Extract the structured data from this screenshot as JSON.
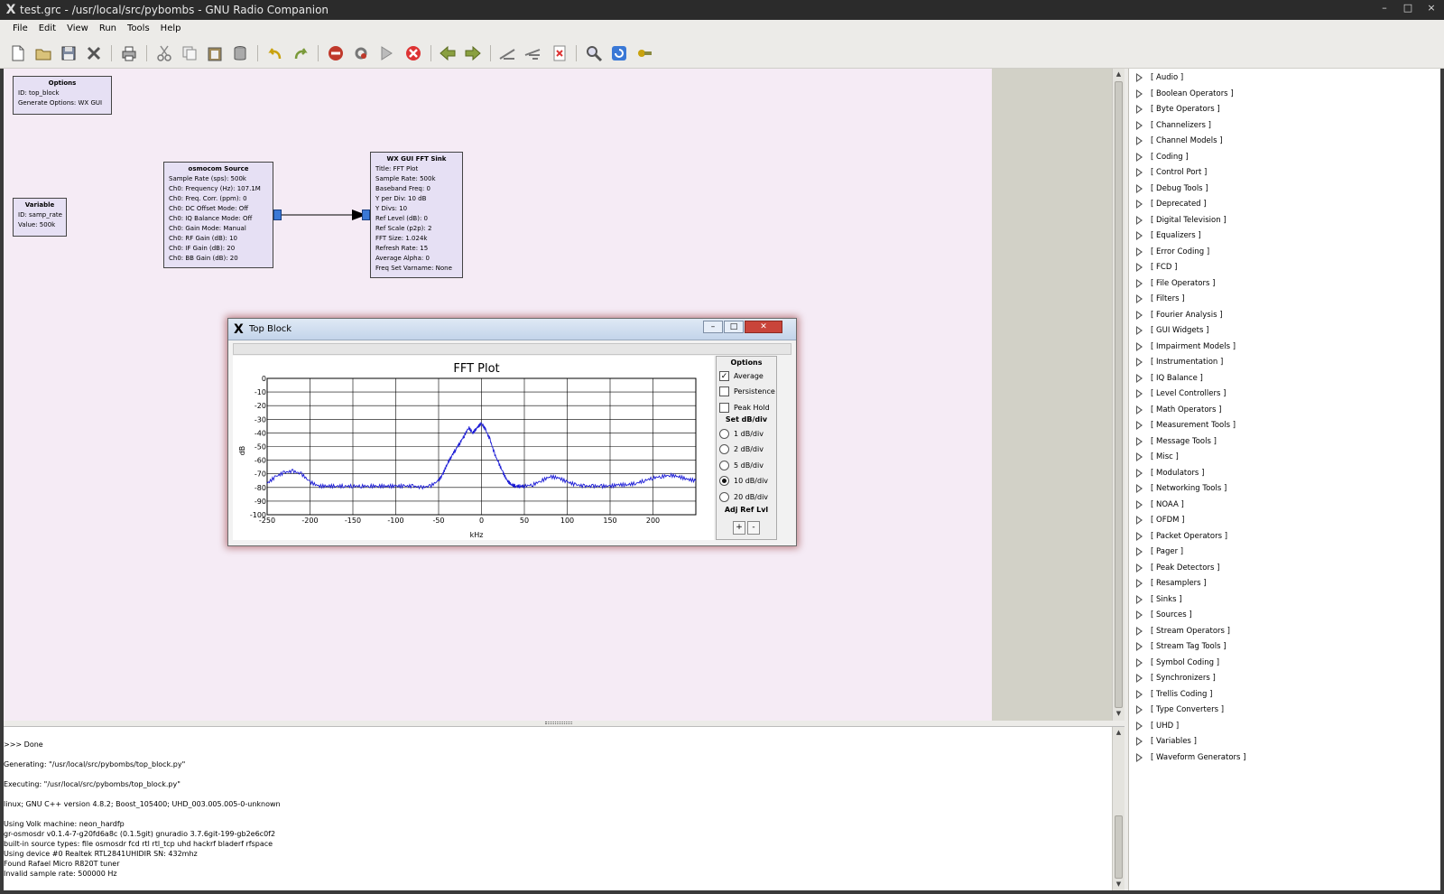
{
  "window": {
    "title": "test.grc - /usr/local/src/pybombs - GNU Radio Companion",
    "controls": [
      "–",
      "□",
      "×"
    ]
  },
  "menu": [
    "File",
    "Edit",
    "View",
    "Run",
    "Tools",
    "Help"
  ],
  "toolbar_icons": [
    "new-icon",
    "open-icon",
    "save-icon",
    "close-icon",
    "print-icon",
    "cut-icon",
    "copy-icon",
    "paste-icon",
    "delete-icon",
    "undo-icon",
    "redo-icon",
    "disable-icon",
    "generate-icon",
    "execute-icon",
    "kill-icon",
    "rotate-ccw-icon",
    "rotate-cw-icon",
    "enable-icon",
    "disable-block-icon",
    "errors-icon",
    "find-icon",
    "reload-icon",
    "open-hier-icon"
  ],
  "blocks": {
    "options": {
      "title": "Options",
      "params": [
        "ID: top_block",
        "Generate Options: WX GUI"
      ]
    },
    "variable": {
      "title": "Variable",
      "params": [
        "ID: samp_rate",
        "Value: 500k"
      ]
    },
    "source": {
      "title": "osmocom Source",
      "params": [
        "Sample Rate (sps): 500k",
        "Ch0: Frequency (Hz): 107.1M",
        "Ch0: Freq. Corr. (ppm): 0",
        "Ch0: DC Offset Mode: Off",
        "Ch0: IQ Balance Mode: Off",
        "Ch0: Gain Mode: Manual",
        "Ch0: RF Gain (dB): 10",
        "Ch0: IF Gain (dB): 20",
        "Ch0: BB Gain (dB): 20"
      ]
    },
    "sink": {
      "title": "WX GUI FFT Sink",
      "params": [
        "Title: FFT Plot",
        "Sample Rate: 500k",
        "Baseband Freq: 0",
        "Y per Div: 10 dB",
        "Y Divs: 10",
        "Ref Level (dB): 0",
        "Ref Scale (p2p): 2",
        "FFT Size: 1.024k",
        "Refresh Rate: 15",
        "Average Alpha: 0",
        "Freq Set Varname: None"
      ]
    }
  },
  "top_block_window": {
    "title": "Top Block",
    "options": {
      "heading": "Options",
      "checkboxes": [
        {
          "label": "Average",
          "checked": true
        },
        {
          "label": "Persistence",
          "checked": false
        },
        {
          "label": "Peak Hold",
          "checked": false
        }
      ],
      "div_heading": "Set dB/div",
      "radios": [
        {
          "label": "1 dB/div",
          "selected": false
        },
        {
          "label": "2 dB/div",
          "selected": false
        },
        {
          "label": "5 dB/div",
          "selected": false
        },
        {
          "label": "10 dB/div",
          "selected": true
        },
        {
          "label": "20 dB/div",
          "selected": false
        }
      ],
      "ref_heading": "Adj Ref Lvl",
      "plus": "+",
      "minus": "-"
    }
  },
  "chart_data": {
    "type": "line",
    "title": "FFT Plot",
    "xlabel": "kHz",
    "ylabel": "dB",
    "xlim": [
      -250,
      250
    ],
    "ylim": [
      -100,
      0
    ],
    "x_ticks": [
      -250,
      -200,
      -150,
      -100,
      -50,
      0,
      50,
      100,
      150,
      200
    ],
    "y_ticks": [
      0,
      -10,
      -20,
      -30,
      -40,
      -50,
      -60,
      -70,
      -80,
      -90,
      -100
    ],
    "grid": true,
    "series": [
      {
        "color": "#1a1ad6",
        "x": [
          -250,
          -240,
          -230,
          -220,
          -210,
          -200,
          -190,
          -180,
          -170,
          -160,
          -150,
          -140,
          -130,
          -120,
          -110,
          -100,
          -90,
          -80,
          -70,
          -60,
          -50,
          -45,
          -40,
          -35,
          -30,
          -25,
          -20,
          -15,
          -10,
          -5,
          0,
          5,
          10,
          15,
          20,
          25,
          30,
          35,
          40,
          45,
          50,
          60,
          70,
          80,
          90,
          100,
          110,
          120,
          130,
          140,
          150,
          160,
          170,
          180,
          190,
          200,
          210,
          220,
          230,
          240,
          250
        ],
        "y": [
          -77,
          -72,
          -69,
          -68,
          -70,
          -76,
          -79,
          -79,
          -79,
          -79,
          -79,
          -79,
          -79,
          -79,
          -79,
          -79,
          -79,
          -79,
          -80,
          -79,
          -75,
          -70,
          -63,
          -57,
          -52,
          -47,
          -42,
          -36,
          -40,
          -36,
          -33,
          -38,
          -45,
          -55,
          -62,
          -69,
          -75,
          -78,
          -79,
          -79,
          -79,
          -78,
          -75,
          -72,
          -73,
          -76,
          -78,
          -79,
          -79,
          -79,
          -79,
          -78,
          -78,
          -77,
          -75,
          -73,
          -72,
          -71,
          -72,
          -74,
          -75
        ]
      }
    ]
  },
  "console_lines": [
    ">>> Done",
    "Generating: \"/usr/local/src/pybombs/top_block.py\"",
    "Executing: \"/usr/local/src/pybombs/top_block.py\"",
    "linux; GNU C++ version 4.8.2; Boost_105400; UHD_003.005.005-0-unknown",
    "Using Volk machine: neon_hardfp",
    "gr-osmosdr v0.1.4-7-g20fd6a8c (0.1.5git) gnuradio 3.7.6git-199-gb2e6c0f2",
    "built-in source types: file osmosdr fcd rtl rtl_tcp uhd hackrf bladerf rfspace",
    "Using device #0 Realtek RTL2841UHIDIR SN: 432mhz",
    "Found Rafael Micro R820T tuner",
    "Invalid sample rate: 500000 Hz"
  ],
  "block_tree": [
    "[ Audio ]",
    "[ Boolean Operators ]",
    "[ Byte Operators ]",
    "[ Channelizers ]",
    "[ Channel Models ]",
    "[ Coding ]",
    "[ Control Port ]",
    "[ Debug Tools ]",
    "[ Deprecated ]",
    "[ Digital Television ]",
    "[ Equalizers ]",
    "[ Error Coding ]",
    "[ FCD ]",
    "[ File Operators ]",
    "[ Filters ]",
    "[ Fourier Analysis ]",
    "[ GUI Widgets ]",
    "[ Impairment Models ]",
    "[ Instrumentation ]",
    "[ IQ Balance ]",
    "[ Level Controllers ]",
    "[ Math Operators ]",
    "[ Measurement Tools ]",
    "[ Message Tools ]",
    "[ Misc ]",
    "[ Modulators ]",
    "[ Networking Tools ]",
    "[ NOAA ]",
    "[ OFDM ]",
    "[ Packet Operators ]",
    "[ Pager ]",
    "[ Peak Detectors ]",
    "[ Resamplers ]",
    "[ Sinks ]",
    "[ Sources ]",
    "[ Stream Operators ]",
    "[ Stream Tag Tools ]",
    "[ Symbol Coding ]",
    "[ Synchronizers ]",
    "[ Trellis Coding ]",
    "[ Type Converters ]",
    "[ UHD ]",
    "[ Variables ]",
    "[ Waveform Generators ]"
  ]
}
